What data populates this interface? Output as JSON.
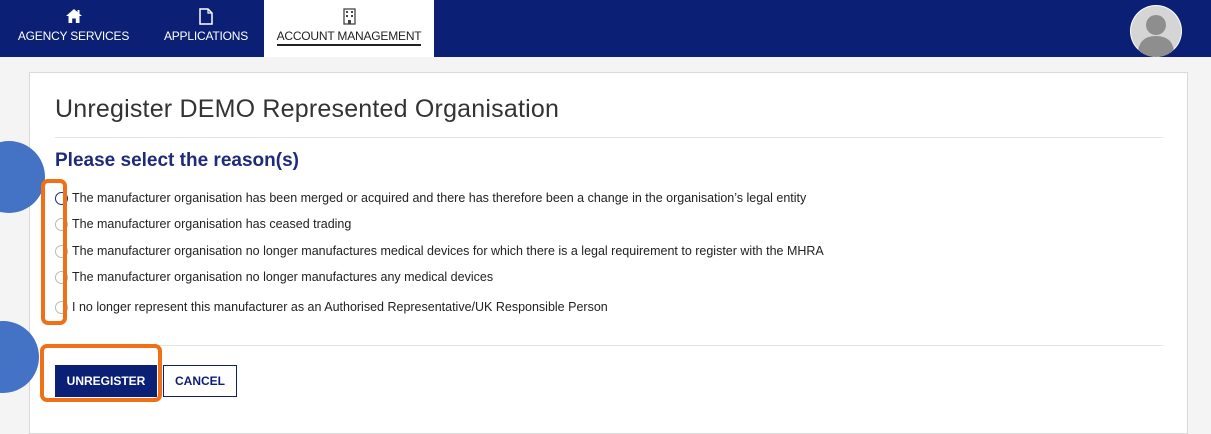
{
  "nav": {
    "items": [
      {
        "label": "AGENCY SERVICES",
        "icon": "home-icon"
      },
      {
        "label": "APPLICATIONS",
        "icon": "document-icon"
      },
      {
        "label": "ACCOUNT MANAGEMENT",
        "icon": "building-icon",
        "active": true
      }
    ],
    "avatar_icon": "user-avatar-icon"
  },
  "page": {
    "title": "Unregister DEMO Represented Organisation",
    "section_heading": "Please select the reason(s)",
    "reasons": [
      "The manufacturer organisation has been merged or acquired and there has therefore been a change in the organisation’s legal entity",
      "The manufacturer organisation has ceased trading",
      "The manufacturer organisation no longer manufactures medical devices for which there is a legal requirement to register with the MHRA",
      "The manufacturer organisation no longer manufactures any medical devices",
      "I no longer represent this manufacturer as an Authorised Representative/UK Responsible Person"
    ],
    "buttons": {
      "unregister": "UNREGISTER",
      "cancel": "CANCEL"
    }
  },
  "colors": {
    "nav_background": "#0b1f74",
    "heading": "#1d2b7a",
    "primary_button": "#0b1f74",
    "annotation_highlight": "#f07018",
    "annotation_marker": "#4472c4"
  }
}
